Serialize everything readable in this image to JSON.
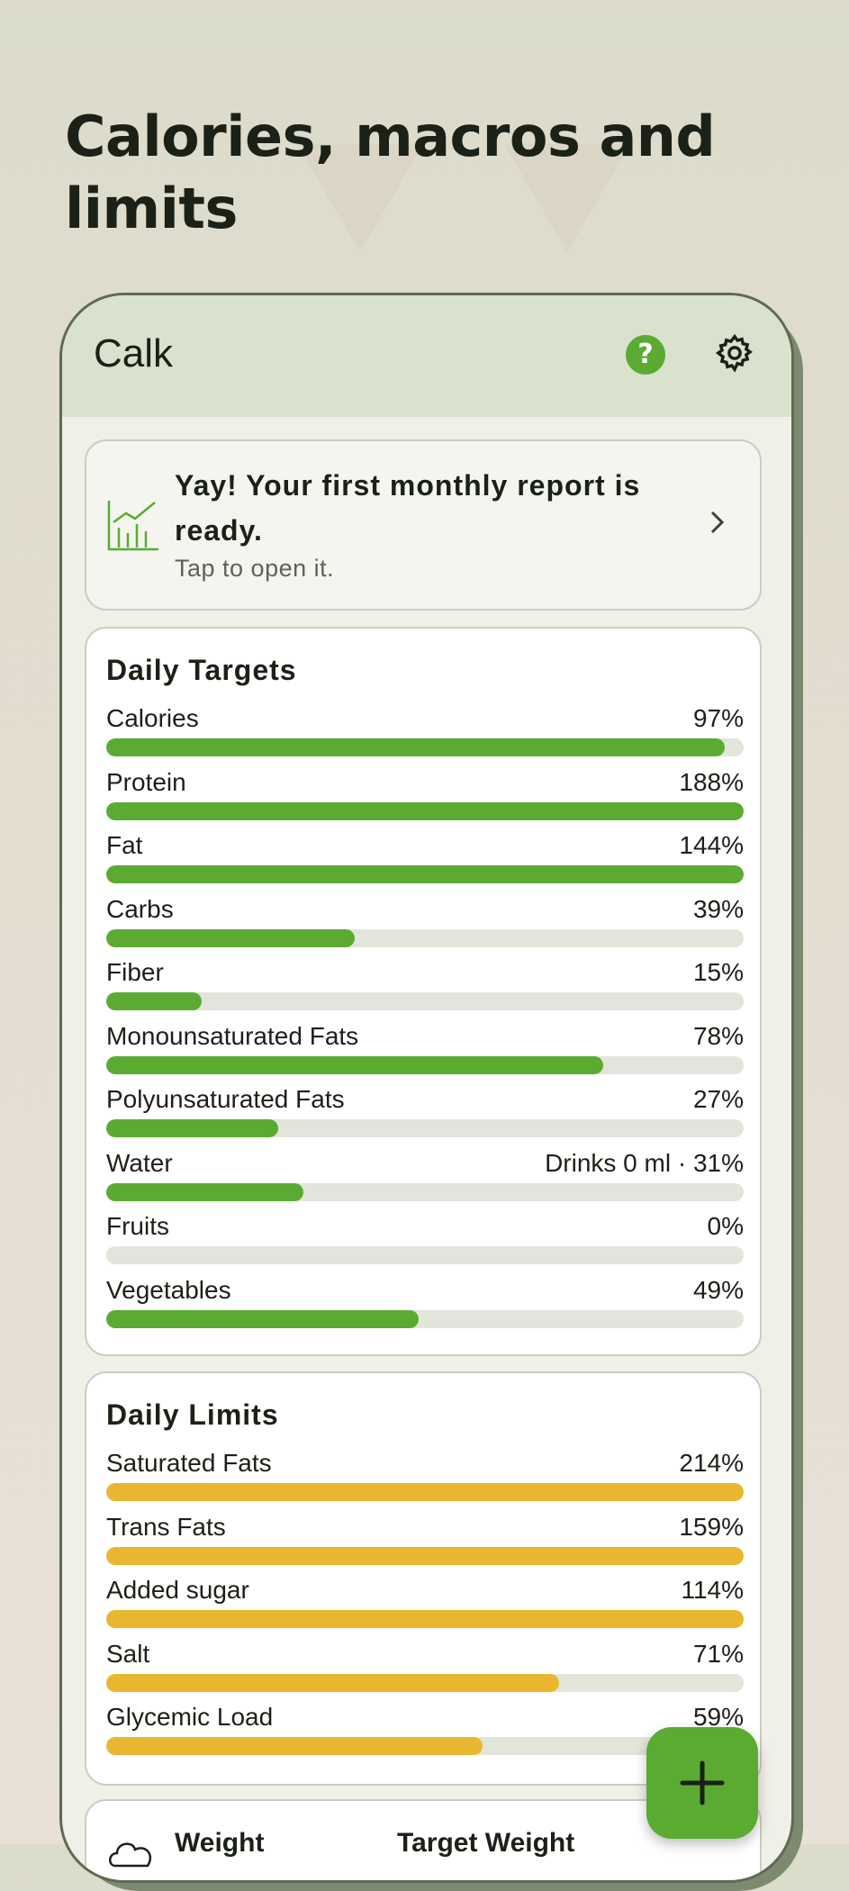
{
  "headline": "Calories, macros and limits",
  "app": {
    "title": "Calk"
  },
  "report_banner": {
    "title": "Yay! Your first monthly report is ready.",
    "subtitle": "Tap to open it."
  },
  "colors": {
    "target_fill": "#5bab32",
    "limit_fill": "#e9b630",
    "track": "#e2e6da"
  },
  "daily_targets": {
    "title": "Daily Targets",
    "items": [
      {
        "label": "Calories",
        "value_text": "97%",
        "progress": 0.97
      },
      {
        "label": "Protein",
        "value_text": "188%",
        "progress": 1.0
      },
      {
        "label": "Fat",
        "value_text": "144%",
        "progress": 1.0
      },
      {
        "label": "Carbs",
        "value_text": "39%",
        "progress": 0.39
      },
      {
        "label": "Fiber",
        "value_text": "15%",
        "progress": 0.15
      },
      {
        "label": "Monounsaturated Fats",
        "value_text": "78%",
        "progress": 0.78
      },
      {
        "label": "Polyunsaturated Fats",
        "value_text": "27%",
        "progress": 0.27
      },
      {
        "label": "Water",
        "value_text": "Drinks 0 ml · 31%",
        "progress": 0.31
      },
      {
        "label": "Fruits",
        "value_text": "0%",
        "progress": 0.0
      },
      {
        "label": "Vegetables",
        "value_text": "49%",
        "progress": 0.49
      }
    ]
  },
  "daily_limits": {
    "title": "Daily Limits",
    "items": [
      {
        "label": "Saturated Fats",
        "value_text": "214%",
        "progress": 1.0
      },
      {
        "label": "Trans Fats",
        "value_text": "159%",
        "progress": 1.0
      },
      {
        "label": "Added sugar",
        "value_text": "114%",
        "progress": 1.0
      },
      {
        "label": "Salt",
        "value_text": "71%",
        "progress": 0.71
      },
      {
        "label": "Glycemic Load",
        "value_text": "59%",
        "progress": 0.59
      }
    ]
  },
  "weight_card": {
    "weight_label": "Weight",
    "target_weight_label": "Target Weight"
  },
  "icons": {
    "help": "help-icon",
    "settings": "gear-icon",
    "report": "bar-chart-trend-icon",
    "chevron": "chevron-right-icon",
    "weight": "scale-cloud-icon",
    "fab": "plus-icon"
  }
}
